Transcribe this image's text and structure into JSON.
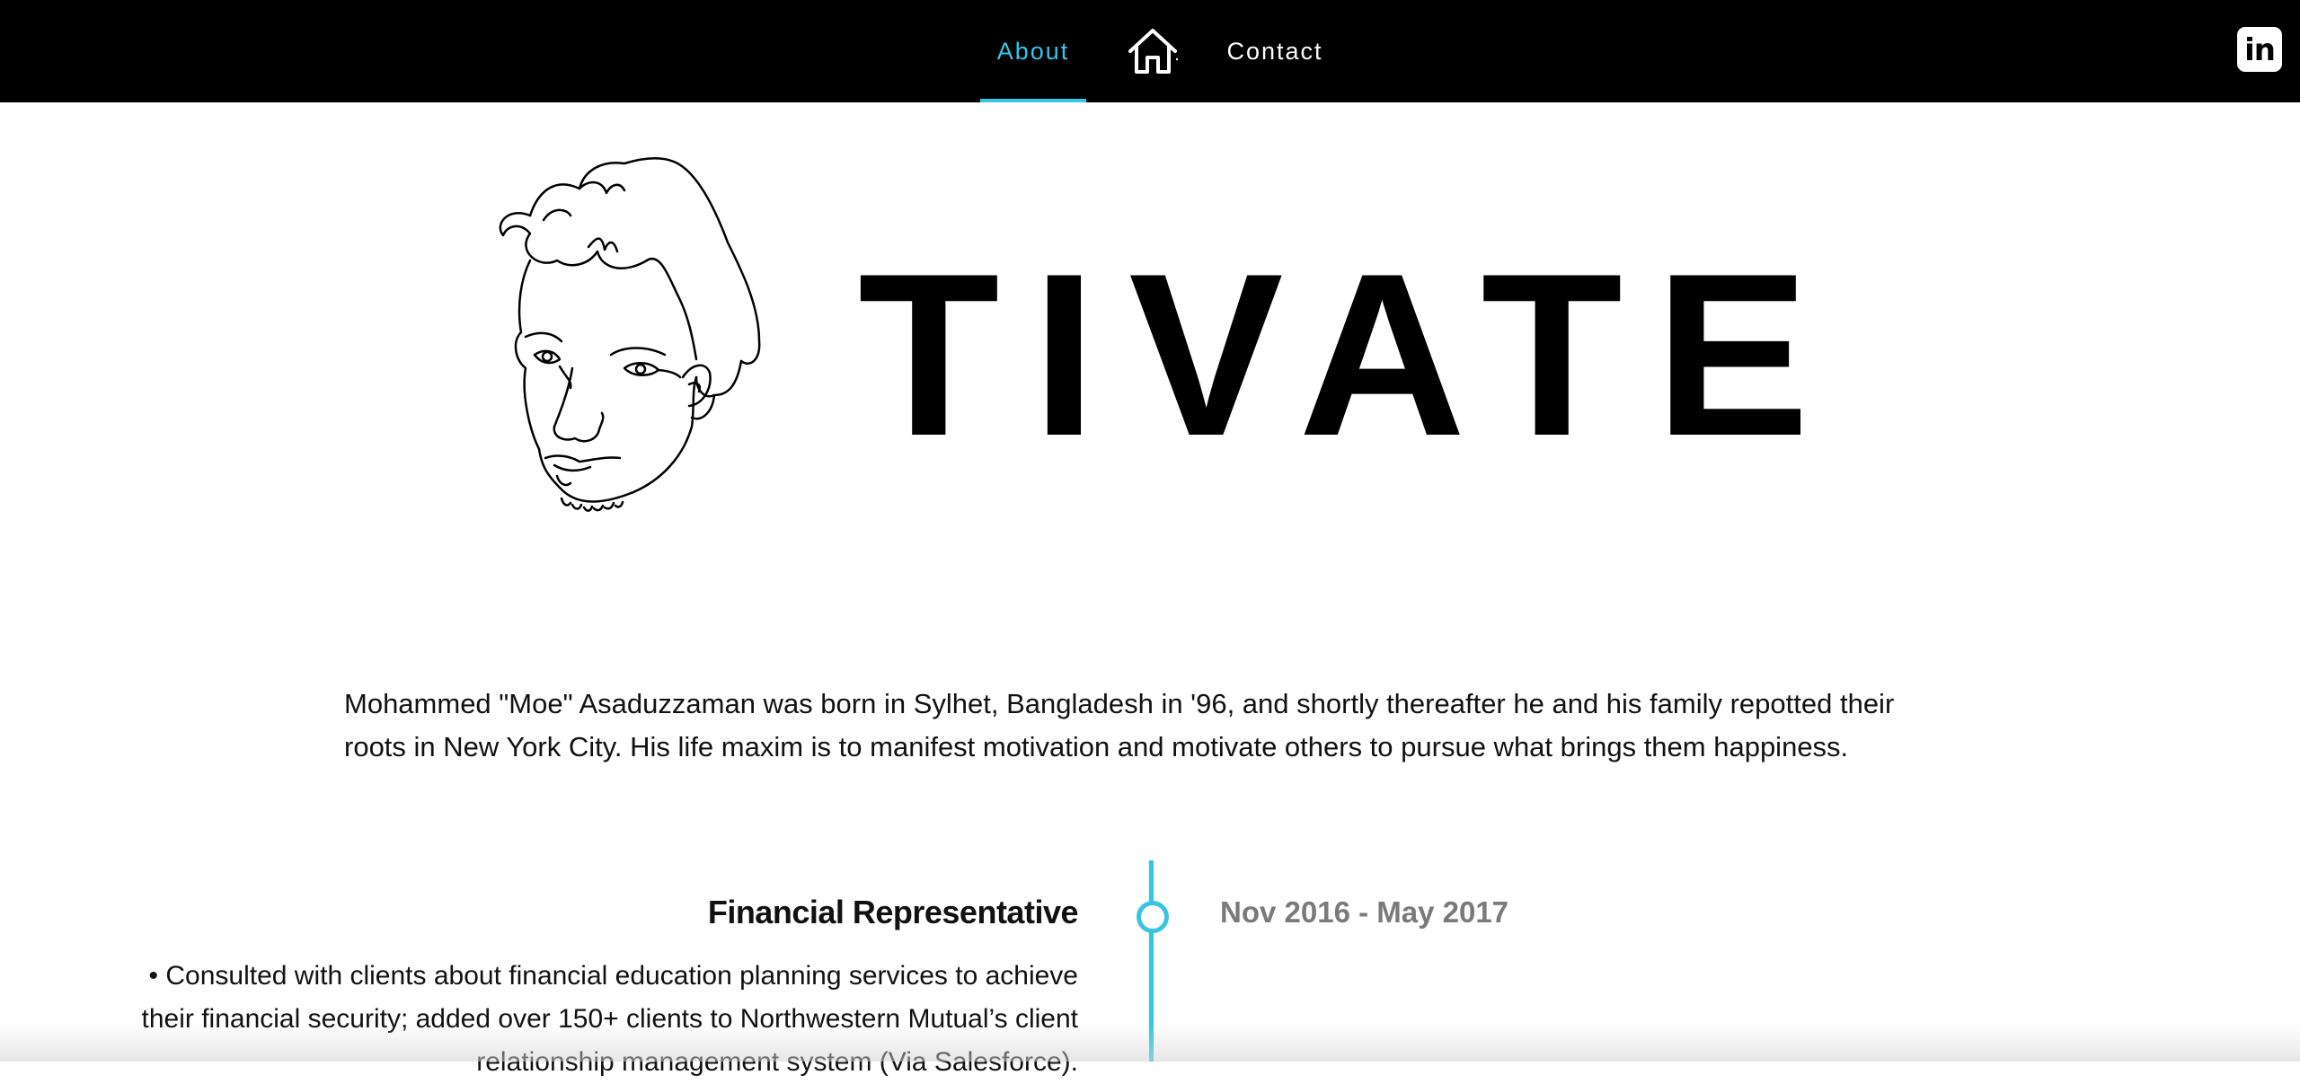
{
  "nav": {
    "items": [
      {
        "label": "About",
        "active": true
      },
      {
        "label": "Contact",
        "active": false
      }
    ],
    "home_icon": "home-icon",
    "social_icon": "linkedin-icon",
    "accent_color": "#37c5e6"
  },
  "hero": {
    "portrait_icon": "face-line-drawing",
    "word": "TIVATE"
  },
  "bio": {
    "text": "Mohammed \"Moe\" Asaduzzaman was born in Sylhet, Bangladesh in '96, and shortly thereafter he and his family repotted their roots in New York City. His life maxim is to manifest motivation and motivate others to pursue what brings them happiness."
  },
  "timeline": {
    "entries": [
      {
        "title": "Financial Representative",
        "date": "Nov 2016 - May 2017",
        "description": "• Consulted with clients about financial education planning services to achieve their financial security; added over 150+ clients to Northwestern Mutual’s client relationship management system (Via Salesforce)."
      }
    ]
  }
}
